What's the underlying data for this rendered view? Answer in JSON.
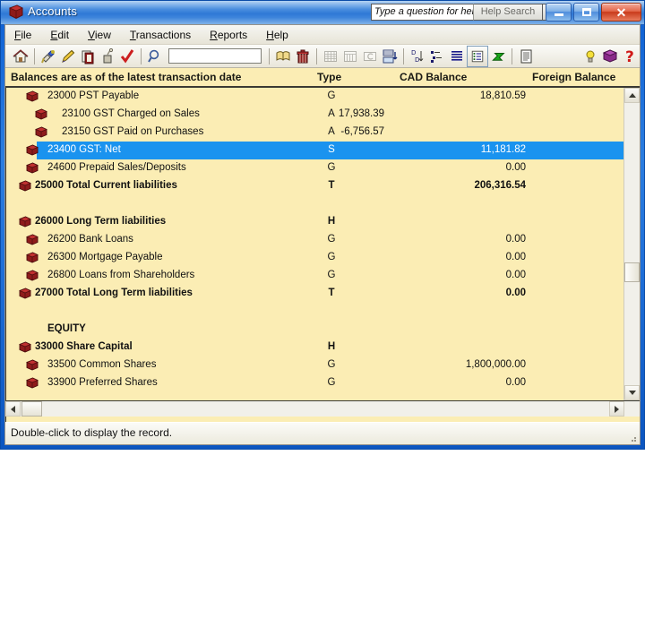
{
  "window": {
    "title": "Accounts",
    "title_icon": "red-book-icon",
    "buttons": {
      "minimize": "minimize-button",
      "maximize": "maximize-button",
      "close": "close-button",
      "close_glyph": "✕"
    }
  },
  "help": {
    "question_value": "Type a question for help",
    "question_placeholder": "Type a question for help",
    "search_label": "Help Search",
    "dropdown": "chevron-down-icon"
  },
  "menu": [
    {
      "label": "File",
      "accel": "F"
    },
    {
      "label": "Edit",
      "accel": "E"
    },
    {
      "label": "View",
      "accel": "V"
    },
    {
      "label": "Transactions",
      "accel": "T"
    },
    {
      "label": "Reports",
      "accel": "R"
    },
    {
      "label": "Help",
      "accel": "H"
    }
  ],
  "toolbar": {
    "search_value": "",
    "items": [
      "home-icon",
      "new-account-icon",
      "edit-pencil-icon",
      "duplicate-icon",
      "remove-icon",
      "check-mark-icon",
      "search-magnifier-icon",
      "open-book-icon",
      "trash-icon",
      "grid-table-icon",
      "calendar-grid-icon",
      "history-icon",
      "export-layout-icon",
      "sort-ascending-icon",
      "sort-descending-icon",
      "list-lines-icon",
      "detail-list-icon",
      "refresh-arrow-icon",
      "report-page-icon",
      "hint-bulb-icon",
      "help-book-icon",
      "help-question-icon"
    ]
  },
  "list": {
    "columns": {
      "description": "Balances are as of the latest transaction date",
      "type": "Type",
      "cad_balance": "CAD Balance",
      "foreign_balance": "Foreign Balance"
    },
    "rows": [
      {
        "icon": "book-icon",
        "name": "23000 PST Payable",
        "type": "G",
        "cad": "18,810.59",
        "indent": 1,
        "bold": false,
        "selected": false,
        "cad_align": "right"
      },
      {
        "icon": "book-icon",
        "name": "23100 GST Charged on Sales",
        "type": "A",
        "cad": "17,938.39",
        "indent": 2,
        "bold": false,
        "selected": false,
        "cad_align": "mid"
      },
      {
        "icon": "book-icon",
        "name": "23150 GST Paid on Purchases",
        "type": "A",
        "cad": "-6,756.57",
        "indent": 2,
        "bold": false,
        "selected": false,
        "cad_align": "mid"
      },
      {
        "icon": "book-icon",
        "name": "23400 GST: Net",
        "type": "S",
        "cad": "11,181.82",
        "indent": 1,
        "bold": false,
        "selected": true,
        "cad_align": "right"
      },
      {
        "icon": "book-icon",
        "name": "24600 Prepaid Sales/Deposits",
        "type": "G",
        "cad": "0.00",
        "indent": 1,
        "bold": false,
        "selected": false,
        "cad_align": "right"
      },
      {
        "icon": "book-icon",
        "name": "25000 Total Current liabilities",
        "type": "T",
        "cad": "206,316.54",
        "indent": 0,
        "bold": true,
        "selected": false,
        "cad_align": "right"
      },
      {
        "icon": "",
        "name": "",
        "type": "",
        "cad": "",
        "indent": 0,
        "bold": false,
        "selected": false,
        "cad_align": "right"
      },
      {
        "icon": "book-icon",
        "name": "26000 Long Term liabilities",
        "type": "H",
        "cad": "",
        "indent": 0,
        "bold": true,
        "selected": false,
        "cad_align": "right"
      },
      {
        "icon": "book-icon",
        "name": "26200 Bank Loans",
        "type": "G",
        "cad": "0.00",
        "indent": 1,
        "bold": false,
        "selected": false,
        "cad_align": "right"
      },
      {
        "icon": "book-icon",
        "name": "26300 Mortgage Payable",
        "type": "G",
        "cad": "0.00",
        "indent": 1,
        "bold": false,
        "selected": false,
        "cad_align": "right"
      },
      {
        "icon": "book-icon",
        "name": "26800 Loans from Shareholders",
        "type": "G",
        "cad": "0.00",
        "indent": 1,
        "bold": false,
        "selected": false,
        "cad_align": "right"
      },
      {
        "icon": "book-icon",
        "name": "27000 Total Long Term liabilities",
        "type": "T",
        "cad": "0.00",
        "indent": 0,
        "bold": true,
        "selected": false,
        "cad_align": "right"
      },
      {
        "icon": "",
        "name": "",
        "type": "",
        "cad": "",
        "indent": 0,
        "bold": false,
        "selected": false,
        "cad_align": "right"
      },
      {
        "icon": "",
        "name": "EQUITY",
        "type": "",
        "cad": "",
        "indent": 1,
        "bold": true,
        "selected": false,
        "cad_align": "right"
      },
      {
        "icon": "book-icon",
        "name": "33000 Share Capital",
        "type": "H",
        "cad": "",
        "indent": 0,
        "bold": true,
        "selected": false,
        "cad_align": "right"
      },
      {
        "icon": "book-icon",
        "name": "33500 Common Shares",
        "type": "G",
        "cad": "1,800,000.00",
        "indent": 1,
        "bold": false,
        "selected": false,
        "cad_align": "right"
      },
      {
        "icon": "book-icon",
        "name": "33900 Preferred Shares",
        "type": "G",
        "cad": "0.00",
        "indent": 1,
        "bold": false,
        "selected": false,
        "cad_align": "right"
      }
    ]
  },
  "statusbar": {
    "message": "Double-click to display the record."
  },
  "colors": {
    "list_background": "#fbedb4",
    "selection": "#1a93ef",
    "selection_text": "#ffffff",
    "title_gradient_start": "#8ab8ec",
    "close_button": "#c93a1b",
    "book_icon": "#8e1b1b"
  }
}
